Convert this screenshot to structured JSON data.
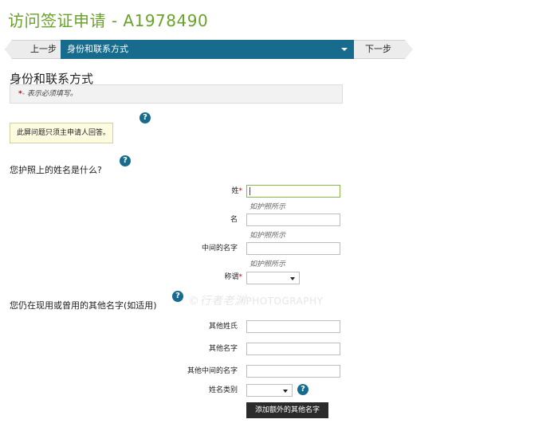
{
  "page": {
    "title": "访问签证申请 - A1978490"
  },
  "nav": {
    "prev_label": "上一步",
    "current_label": "身份和联系方式",
    "next_label": "下一步"
  },
  "section": {
    "title": "身份和联系方式",
    "required_star": "*",
    "required_note": "- 表示必须填写。"
  },
  "note": {
    "text": "此屏问题只须主申请人回答。"
  },
  "help_icon": "?",
  "passport_name": {
    "question": "您护照上的姓名是什么?",
    "surname_label": "姓",
    "surname_value": "",
    "surname_hint": "如护照所示",
    "given_label": "名",
    "given_value": "",
    "given_hint": "如护照所示",
    "middle_label": "中间的名字",
    "middle_value": "",
    "middle_hint": "如护照所示",
    "title_label": "称谓",
    "title_value": "",
    "required_star": "*"
  },
  "other_names": {
    "question": "您仍在现用或曾用的其他名字(如适用)",
    "other_surname_label": "其他姓氏",
    "other_given_label": "其他名字",
    "other_middle_label": "其他中间的名字",
    "name_type_label": "姓名类别",
    "name_type_value": "",
    "add_button": "添加额外的其他名字"
  },
  "watermark": {
    "text": "©行者老渊",
    "suffix": "PHOTOGRAPHY"
  },
  "colors": {
    "title_green": "#6aa329",
    "nav_blue": "#176c8e",
    "required_red": "#cc0000",
    "note_yellow": "#fdfce0",
    "button_dark": "#2b2b2b"
  }
}
